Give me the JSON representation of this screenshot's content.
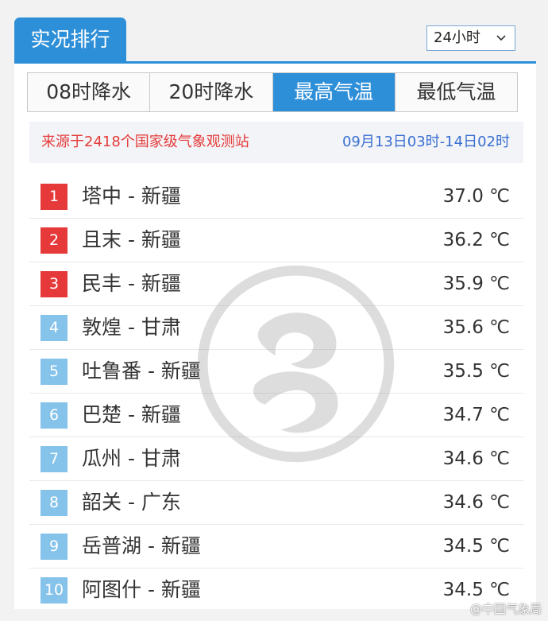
{
  "header": {
    "title": "实况排行",
    "period_select": "24小时"
  },
  "tabs": [
    {
      "label": "08时降水",
      "active": false
    },
    {
      "label": "20时降水",
      "active": false
    },
    {
      "label": "最高气温",
      "active": true
    },
    {
      "label": "最低气温",
      "active": false
    }
  ],
  "source": {
    "note": "来源于2418个国家级气象观测站",
    "time_range": "09月13日03时-14日02时"
  },
  "rankings": [
    {
      "rank": "1",
      "station": "塔中 - 新疆",
      "temp": "37.0 ℃"
    },
    {
      "rank": "2",
      "station": "且末 - 新疆",
      "temp": "36.2 ℃"
    },
    {
      "rank": "3",
      "station": "民丰 - 新疆",
      "temp": "35.9 ℃"
    },
    {
      "rank": "4",
      "station": "敦煌 - 甘肃",
      "temp": "35.6 ℃"
    },
    {
      "rank": "5",
      "station": "吐鲁番 - 新疆",
      "temp": "35.5 ℃"
    },
    {
      "rank": "6",
      "station": "巴楚 - 新疆",
      "temp": "34.7 ℃"
    },
    {
      "rank": "7",
      "station": "瓜州 - 甘肃",
      "temp": "34.6 ℃"
    },
    {
      "rank": "8",
      "station": "韶关 - 广东",
      "temp": "34.6 ℃"
    },
    {
      "rank": "9",
      "station": "岳普湖 - 新疆",
      "temp": "34.5 ℃"
    },
    {
      "rank": "10",
      "station": "阿图什 - 新疆",
      "temp": "34.5 ℃"
    }
  ],
  "watermark": {
    "credit": "@中国气象局"
  },
  "colors": {
    "accent": "#2e8fd9",
    "top_rank": "#e5393a",
    "other_rank": "#86c3ea",
    "source_note": "#e53b3b",
    "time_range": "#3a6fd2"
  },
  "icons": {
    "select_arrow": "chevron-down-icon"
  }
}
